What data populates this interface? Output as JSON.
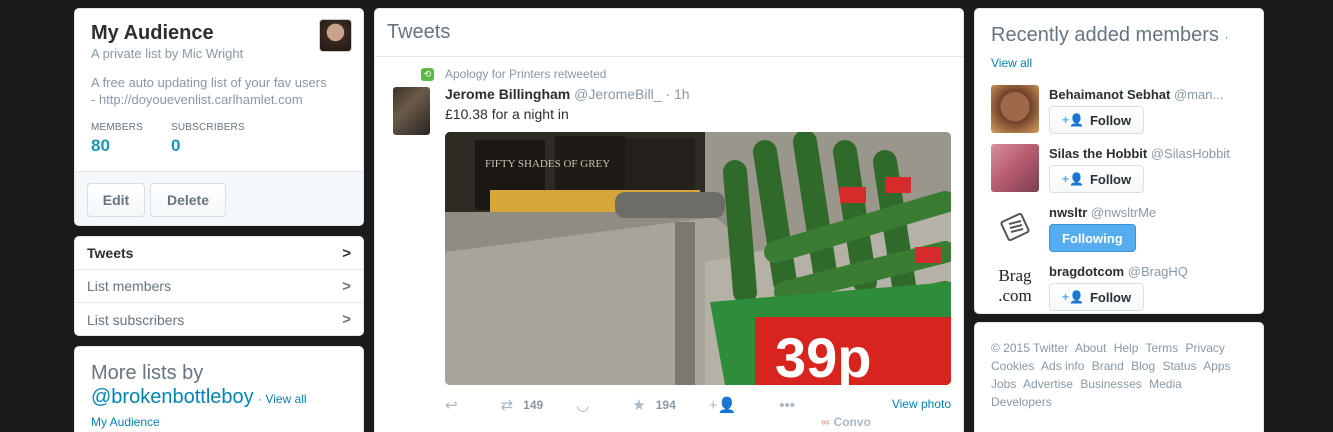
{
  "list": {
    "title": "My Audience",
    "byline": "A private list by Mic Wright",
    "description": "A free auto updating list of your fav users - http://doyouevenlist.carlhamlet.com",
    "stats": [
      {
        "label": "MEMBERS",
        "value": "80"
      },
      {
        "label": "SUBSCRIBERS",
        "value": "0"
      }
    ],
    "edit_label": "Edit",
    "delete_label": "Delete"
  },
  "nav": [
    {
      "label": "Tweets",
      "active": true
    },
    {
      "label": "List members",
      "active": false
    },
    {
      "label": "List subscribers",
      "active": false
    }
  ],
  "more_lists": {
    "title_line1": "More lists by",
    "handle": "@brokenbottleboy",
    "view_all": "· View all",
    "first_list": "My Audience"
  },
  "tweets": {
    "header": "Tweets",
    "items": [
      {
        "retweeted_by": "Apology for Printers retweeted",
        "name": "Jerome Billingham",
        "handle": "@JeromeBill_",
        "time": "· 1h",
        "text": "£10.38 for a night in",
        "retweets": "149",
        "favorites": "194",
        "view_photo": "View photo",
        "convo": "Convo",
        "photo_text": {
          "book_title": "FIFTY SHADES OF GREY",
          "price_sign": "39p",
          "tag": "39p"
        }
      }
    ]
  },
  "members": {
    "title": "Recently added members",
    "view_all": "· View all",
    "items": [
      {
        "name": "Behaimanot Sebhat",
        "handle": "@man...",
        "button": "Follow",
        "following": false
      },
      {
        "name": "Silas the Hobbit",
        "handle": "@SilasHobbit",
        "button": "Follow",
        "following": false
      },
      {
        "name": "nwsltr",
        "handle": "@nwsltrMe",
        "button": "Following",
        "following": true
      },
      {
        "name": "bragdotcom",
        "handle": "@BragHQ",
        "button": "Follow",
        "following": false,
        "avatar_text": "Brag .com"
      }
    ]
  },
  "footer": {
    "links": [
      "© 2015 Twitter",
      "About",
      "Help",
      "Terms",
      "Privacy",
      "Cookies",
      "Ads info",
      "Brand",
      "Blog",
      "Status",
      "Apps",
      "Jobs",
      "Advertise",
      "Businesses",
      "Media",
      "Developers"
    ]
  },
  "colors": {
    "background": "#1a1a1a",
    "accent": "#1b95b0",
    "link": "#0084b4",
    "follow_blue": "#55acee",
    "retweet_green": "#5fb844"
  }
}
